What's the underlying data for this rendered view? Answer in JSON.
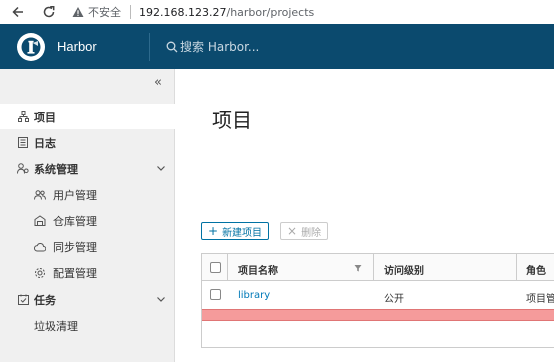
{
  "browser": {
    "insecure_label": "不安全",
    "url_host": "192.168.123.27",
    "url_path": "/harbor/projects"
  },
  "header": {
    "brand": "Harbor",
    "search_placeholder": "搜索 Harbor..."
  },
  "sidebar": {
    "collapse_symbol": "«",
    "items": [
      {
        "label": "项目",
        "icon": "projects-icon"
      },
      {
        "label": "日志",
        "icon": "logs-icon"
      },
      {
        "label": "系统管理",
        "icon": "admin-icon"
      },
      {
        "label": "用户管理",
        "icon": "users-icon"
      },
      {
        "label": "仓库管理",
        "icon": "registries-icon"
      },
      {
        "label": "同步管理",
        "icon": "replication-icon"
      },
      {
        "label": "配置管理",
        "icon": "config-icon"
      },
      {
        "label": "任务",
        "icon": "tasks-icon"
      },
      {
        "label": "垃圾清理",
        "icon": ""
      }
    ]
  },
  "main": {
    "title": "项目",
    "new_project_label": "新建项目",
    "delete_label": "删除",
    "table": {
      "columns": [
        "项目名称",
        "访问级别",
        "角色"
      ],
      "rows": [
        {
          "name": "library",
          "access": "公开",
          "role": "项目管"
        }
      ]
    }
  },
  "colors": {
    "header_bg": "#0b4a6e",
    "link": "#0079b8",
    "highlight": "#f59b9b"
  }
}
